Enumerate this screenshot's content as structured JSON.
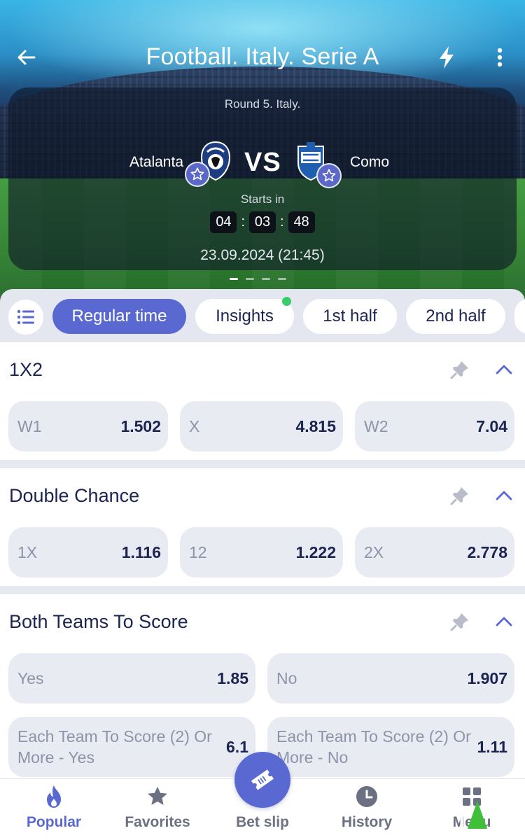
{
  "header": {
    "title": "Football. Italy. Serie A"
  },
  "match": {
    "round": "Round 5. Italy.",
    "team1": "Atalanta",
    "team2": "Como",
    "vs": "VS",
    "starts_in_label": "Starts in",
    "timer": {
      "hours": "04",
      "minutes": "03",
      "seconds": "48"
    },
    "timer_sep": ":",
    "datetime": "23.09.2024 (21:45)",
    "carousel_pages": 4,
    "carousel_active": 1
  },
  "filters": {
    "tabs": [
      {
        "label": "Regular time",
        "active": true
      },
      {
        "label": "Insights",
        "active": false,
        "has_indicator": true
      },
      {
        "label": "1st half",
        "active": false
      },
      {
        "label": "2nd half",
        "active": false
      }
    ]
  },
  "markets": [
    {
      "title": "1X2",
      "outcomes": [
        {
          "label": "W1",
          "odds": "1.502"
        },
        {
          "label": "X",
          "odds": "4.815"
        },
        {
          "label": "W2",
          "odds": "7.04"
        }
      ]
    },
    {
      "title": "Double Chance",
      "outcomes": [
        {
          "label": "1X",
          "odds": "1.116"
        },
        {
          "label": "12",
          "odds": "1.222"
        },
        {
          "label": "2X",
          "odds": "2.778"
        }
      ]
    },
    {
      "title": "Both Teams To Score",
      "outcomes": [
        {
          "label": "Yes",
          "odds": "1.85"
        },
        {
          "label": "No",
          "odds": "1.907"
        },
        {
          "label": "Each Team To Score (2) Or More - Yes",
          "odds": "6.1"
        },
        {
          "label": "Each Team To Score (2) Or More - No",
          "odds": "1.11"
        }
      ]
    }
  ],
  "bottom_nav": {
    "items": [
      {
        "label": "Popular",
        "icon": "flame-icon",
        "active": true
      },
      {
        "label": "Favorites",
        "icon": "star-icon",
        "active": false
      },
      {
        "label": "Bet slip",
        "icon": "ticket-icon",
        "active": false
      },
      {
        "label": "History",
        "icon": "clock-icon",
        "active": false
      },
      {
        "label": "Menu",
        "icon": "grid-icon",
        "active": false
      }
    ]
  },
  "colors": {
    "accent": "#5a69d2",
    "text_dark": "#1c2451",
    "indicator": "#3ccb6a"
  }
}
